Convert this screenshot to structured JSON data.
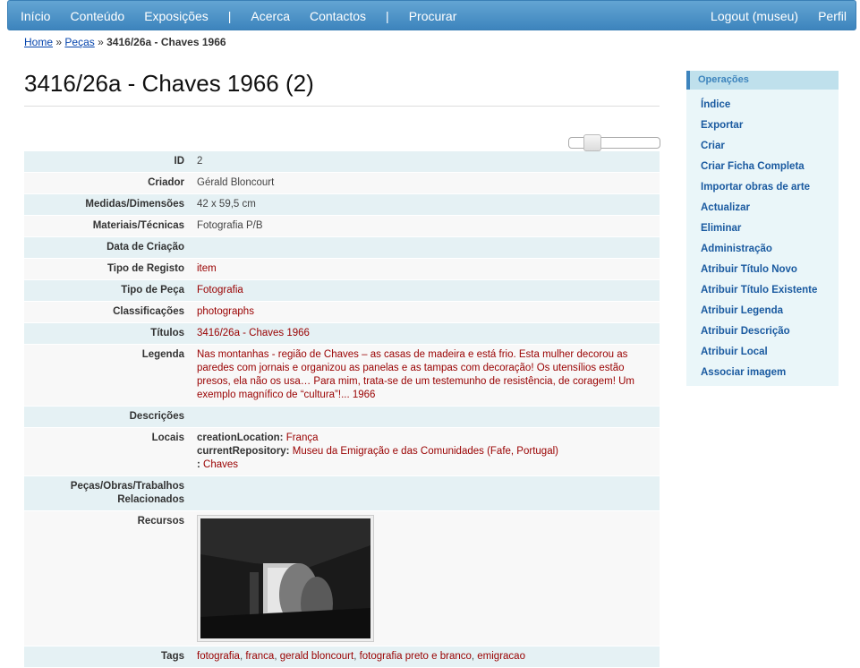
{
  "nav": {
    "left": [
      "Início",
      "Conteúdo",
      "Exposições",
      "|",
      "Acerca",
      "Contactos",
      "|",
      "Procurar"
    ],
    "right": [
      "Logout (museu)",
      "Perfil"
    ]
  },
  "breadcrumb": {
    "home": "Home",
    "sep1": "»",
    "pecas": "Peças",
    "sep2": "»",
    "current": "3416/26a - Chaves 1966"
  },
  "title": "3416/26a - Chaves 1966 (2)",
  "fields": {
    "id": {
      "label": "ID",
      "value": "2"
    },
    "criador": {
      "label": "Criador",
      "value": "Gérald Bloncourt"
    },
    "medidas": {
      "label": "Medidas/Dimensões",
      "value": "42 x 59,5 cm"
    },
    "materiais": {
      "label": "Materiais/Técnicas",
      "value": "Fotografia P/B"
    },
    "data": {
      "label": "Data de Criação",
      "value": ""
    },
    "tipo_registo": {
      "label": "Tipo de Registo",
      "value": "item"
    },
    "tipo_peca": {
      "label": "Tipo de Peça",
      "value": "Fotografia"
    },
    "classificacoes": {
      "label": "Classificações",
      "value": "photographs"
    },
    "titulos": {
      "label": "Títulos",
      "value": "3416/26a - Chaves 1966"
    },
    "legenda": {
      "label": "Legenda",
      "value": "Nas montanhas - região de Chaves – as casas de madeira e está frio. Esta mulher decorou as paredes com jornais e organizou as panelas e as tampas com decoração! Os utensílios estão presos, ela não os usa… Para mim, trata-se de um testemunho de resistência, de coragem! Um exemplo magnífico de “cultura”!... 1966"
    },
    "descricoes": {
      "label": "Descrições",
      "value": ""
    },
    "locais": {
      "label": "Locais",
      "creation_key": "creationLocation:",
      "creation_val": "França",
      "repo_key": "currentRepository:",
      "repo_val": "Museu da Emigração e das Comunidades (Fafe, Portugal)",
      "extra_key": ":",
      "extra_val": "Chaves"
    },
    "relacionados": {
      "label1": "Peças/Obras/Trabalhos",
      "label2": "Relacionados",
      "value": ""
    },
    "recursos": {
      "label": "Recursos"
    },
    "tags": {
      "label": "Tags",
      "items": [
        "fotografia",
        "franca",
        "gerald bloncourt",
        "fotografia preto e branco",
        "emigracao"
      ],
      "sep": ", "
    }
  },
  "operations": {
    "heading": "Operações",
    "items": [
      "Índice",
      "Exportar",
      "Criar",
      "Criar Ficha Completa",
      "Importar obras de arte",
      "Actualizar",
      "Eliminar",
      "Administração",
      "Atribuir Título Novo",
      "Atribuir Título Existente",
      "Atribuir Legenda",
      "Atribuir Descrição",
      "Atribuir Local",
      "Associar imagem"
    ]
  }
}
